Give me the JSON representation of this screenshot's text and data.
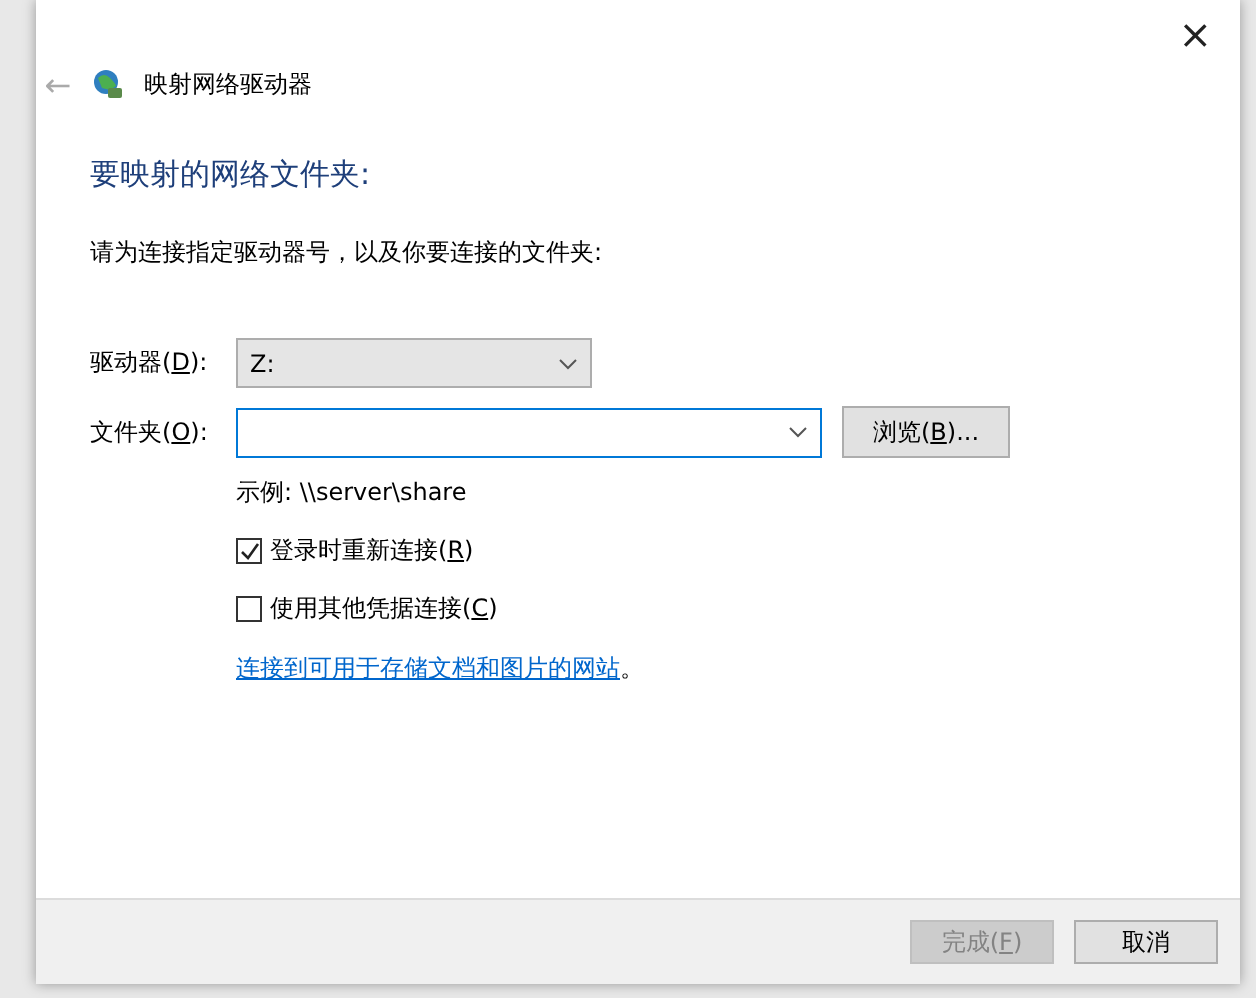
{
  "window": {
    "title": "映射网络驱动器",
    "close": "×",
    "back": "←"
  },
  "heading": "要映射的网络文件夹:",
  "instruction": "请为连接指定驱动器号，以及你要连接的文件夹:",
  "drive": {
    "label": {
      "before": "驱动器(",
      "key": "D",
      "after": "):"
    },
    "value": "Z:"
  },
  "folder": {
    "label": {
      "before": "文件夹(",
      "key": "O",
      "after": "):"
    },
    "focused": true
  },
  "browse_button": {
    "before": "浏览(",
    "key": "B",
    "after": ")..."
  },
  "example": "示例: \\\\server\\share",
  "options": [
    {
      "before": "登录时重新连接(",
      "key": "R",
      "after": ")",
      "checked": true
    },
    {
      "before": "使用其他凭据连接(",
      "key": "C",
      "after": ")",
      "checked": false
    }
  ],
  "link": {
    "text": "连接到可用于存储文档和图片的网站",
    "after": "。"
  },
  "buttons": [
    {
      "before": "完成(",
      "key": "F",
      "after": ")",
      "disabled": true
    },
    {
      "before": "取消",
      "disabled": false
    }
  ]
}
